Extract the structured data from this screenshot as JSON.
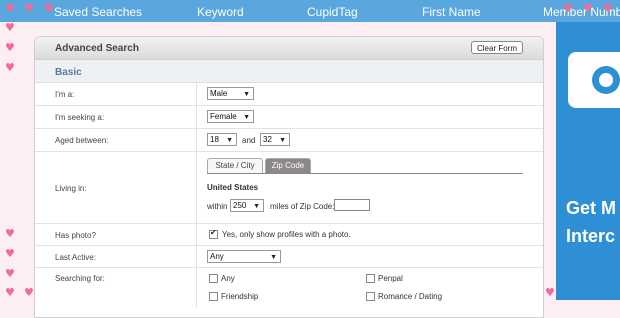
{
  "topnav": {
    "tabs": [
      "Saved Searches",
      "Keyword",
      "CupidTag",
      "First Name",
      "Member Number"
    ]
  },
  "colors": {
    "nav": "#5aa6df",
    "ad": "#2f8fd4",
    "heart": "#f06c99",
    "active_tab": "#8f8888"
  },
  "ad": {
    "line1": "Get M",
    "line2": "Interc",
    "icon": "camera-icon"
  },
  "panel": {
    "title": "Advanced Search",
    "clear_label": "Clear Form",
    "section": "Basic"
  },
  "form": {
    "iam": {
      "label": "I'm a:",
      "value": "Male"
    },
    "seeking": {
      "label": "I'm seeking a:",
      "value": "Female"
    },
    "aged": {
      "label": "Aged between:",
      "from": "18",
      "and": "and",
      "to": "32"
    },
    "living": {
      "label": "Living in:",
      "tab_state": "State / City",
      "tab_zip": "Zip Code",
      "country": "United States",
      "within": "within",
      "miles_value": "250",
      "miles_label": "miles of Zip Code:",
      "zip_value": ""
    },
    "photo": {
      "label": "Has photo?",
      "option": "Yes, only show profiles with a photo."
    },
    "active": {
      "label": "Last Active:",
      "value": "Any"
    },
    "searching": {
      "label": "Searching for:",
      "options": [
        "Any",
        "Penpal",
        "Friendship",
        "Romance / Dating"
      ]
    }
  }
}
